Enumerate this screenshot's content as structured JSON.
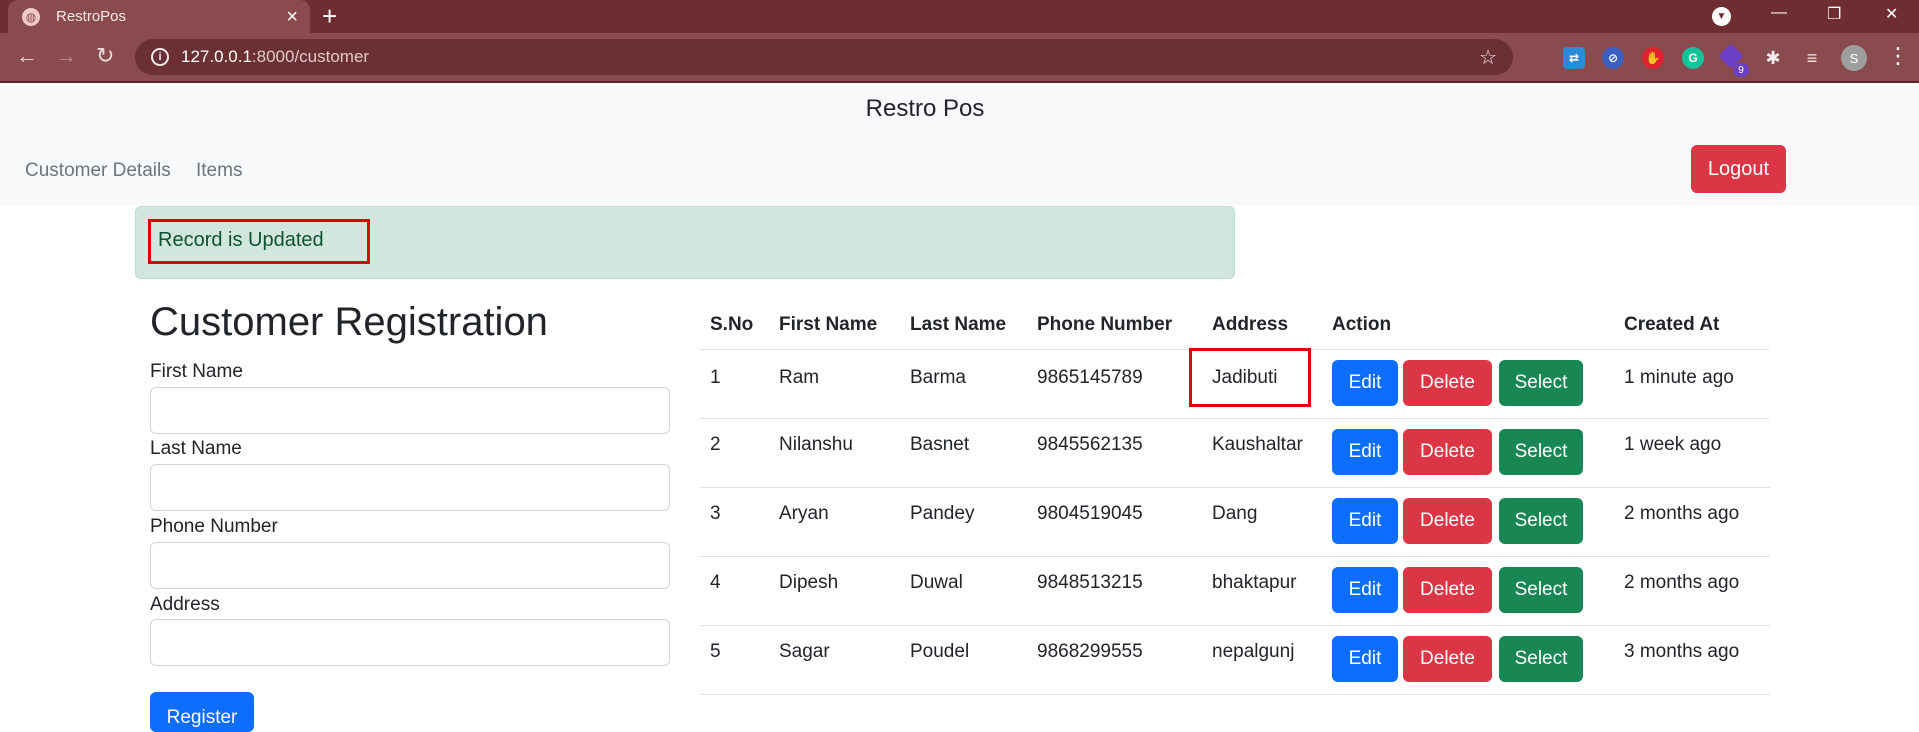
{
  "browser": {
    "tab_title": "RestroPos",
    "url_host": "127.0.0.1",
    "url_path": ":8000/customer",
    "extension_badge": "9",
    "profile_initial": "S"
  },
  "navbar": {
    "brand": "Restro Pos",
    "links": [
      "Customer Details",
      "Items"
    ],
    "logout_label": "Logout"
  },
  "alert": {
    "message": "Record is Updated"
  },
  "form": {
    "title": "Customer Registration",
    "fields": [
      {
        "label": "First Name",
        "value": ""
      },
      {
        "label": "Last Name",
        "value": ""
      },
      {
        "label": "Phone Number",
        "value": ""
      },
      {
        "label": "Address",
        "value": ""
      }
    ],
    "submit_label": "Register"
  },
  "table": {
    "headers": [
      "S.No",
      "First Name",
      "Last Name",
      "Phone Number",
      "Address",
      "Action",
      "Created At"
    ],
    "action_labels": {
      "edit": "Edit",
      "delete": "Delete",
      "select": "Select"
    },
    "rows": [
      {
        "sno": "1",
        "first": "Ram",
        "last": "Barma",
        "phone": "9865145789",
        "address": "Jadibuti",
        "created": "1 minute ago"
      },
      {
        "sno": "2",
        "first": "Nilanshu",
        "last": "Basnet",
        "phone": "9845562135",
        "address": "Kaushaltar",
        "created": "1 week ago"
      },
      {
        "sno": "3",
        "first": "Aryan",
        "last": "Pandey",
        "phone": "9804519045",
        "address": "Dang",
        "created": "2 months ago"
      },
      {
        "sno": "4",
        "first": "Dipesh",
        "last": "Duwal",
        "phone": "9848513215",
        "address": "bhaktapur",
        "created": "2 months ago"
      },
      {
        "sno": "5",
        "first": "Sagar",
        "last": "Poudel",
        "phone": "9868299555",
        "address": "nepalgunj",
        "created": "3 months ago"
      }
    ]
  },
  "colors": {
    "primary": "#0d6efd",
    "danger": "#dc3545",
    "success": "#198754",
    "alert_bg": "#d1e7dd",
    "highlight": "#e00000"
  }
}
